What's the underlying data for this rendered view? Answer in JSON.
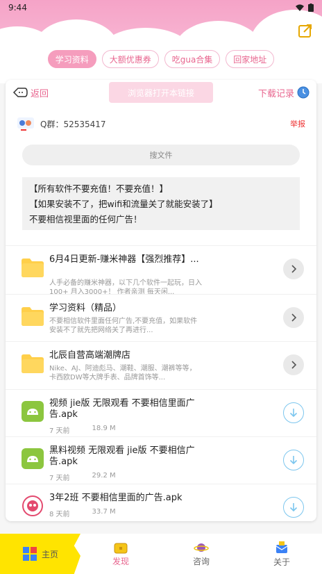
{
  "status_bar": {
    "time": "9:44"
  },
  "chips": [
    {
      "label": "学习资料",
      "active": true
    },
    {
      "label": "大额优惠券",
      "active": false
    },
    {
      "label": "吃gua合集",
      "active": false
    },
    {
      "label": "回家地址",
      "active": false
    }
  ],
  "nav": {
    "back_label": "返回",
    "browser_button_label": "浏览器打开本链接",
    "download_record_label": "下载记录"
  },
  "qq": {
    "text": "Q群：52535417",
    "report_label": "举报"
  },
  "search": {
    "placeholder": "搜文件"
  },
  "notice": [
    "【所有软件不要充值！不要充值！】",
    "【如果安装不了，把wifi和流量关了就能安装了】",
    "不要相信视里面的任何广告！"
  ],
  "items": [
    {
      "type": "folder",
      "title": "6月4日更新-赚米神器【强烈推荐】...",
      "desc": "人手必备的赚米神器，以下几个软件一起玩，日入100+ 月入3000+！ 作者亲测 每天闲...",
      "action": "arrow"
    },
    {
      "type": "folder",
      "title": "学习资料（精品）",
      "desc": "不要相信软件里面任何广告,不要充值，如果软件安装不了就先把网络关了再进行...",
      "action": "arrow"
    },
    {
      "type": "folder",
      "title": "北辰自营高端潮牌店",
      "desc": "Nike、AJ、阿迪彪马、潮鞋、潮服、潮裤等等，卡西欧DW等大牌手表、品牌首饰等...",
      "action": "arrow"
    },
    {
      "type": "apk",
      "title": "视频 jie版 无限观看 不要相信里面广告.apk",
      "time": "7 天前",
      "size": "18.9 M",
      "action": "download"
    },
    {
      "type": "apk",
      "title": "黑料视频 无限观看 jie版 不要相信广告.apk",
      "time": "7 天前",
      "size": "29.2 M",
      "action": "download"
    },
    {
      "type": "app",
      "title": "3年2班 不要相信里面的广告.apk",
      "time": "8 天前",
      "size": "33.7 M",
      "action": "download"
    }
  ],
  "tabbar": [
    {
      "label": "主页"
    },
    {
      "label": "发现"
    },
    {
      "label": "咨询"
    },
    {
      "label": "关于"
    }
  ],
  "colors": {
    "accent_pink": "#e8668f",
    "chip_active": "#f59dbd",
    "home_tab": "#ffe400",
    "download_blue": "#7cc6ee"
  }
}
